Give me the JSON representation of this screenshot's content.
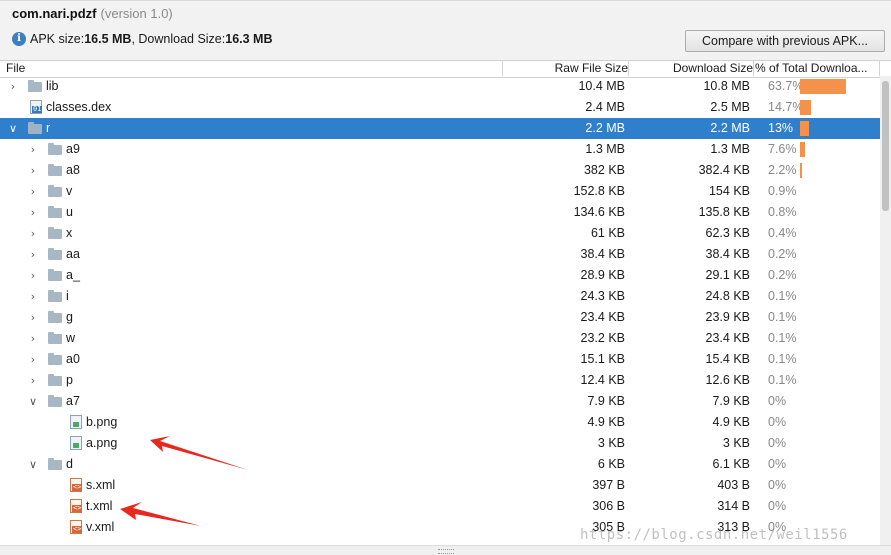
{
  "header": {
    "package": "com.nari.pdzf",
    "version": "(version 1.0)",
    "apk_size_label": "APK size: ",
    "apk_size": "16.5 MB",
    "download_size_label": ", Download Size: ",
    "download_size": "16.3 MB",
    "compare_button": "Compare with previous APK..."
  },
  "columns": {
    "file": "File",
    "raw": "Raw File Size",
    "download": "Download Size",
    "percent": "% of Total Downloa..."
  },
  "rows": [
    {
      "name": "lib",
      "type": "folder",
      "depth": 0,
      "expanded": false,
      "raw": "10.4 MB",
      "dl": "10.8 MB",
      "pct": "63.7%",
      "share": 63.7
    },
    {
      "name": "classes.dex",
      "type": "dex",
      "depth": 0,
      "expanded": null,
      "raw": "2.4 MB",
      "dl": "2.5 MB",
      "pct": "14.7%",
      "share": 14.7
    },
    {
      "name": "r",
      "type": "folder",
      "depth": 0,
      "expanded": true,
      "selected": true,
      "raw": "2.2 MB",
      "dl": "2.2 MB",
      "pct": "13%",
      "share": 13
    },
    {
      "name": "a9",
      "type": "folder",
      "depth": 1,
      "expanded": false,
      "raw": "1.3 MB",
      "dl": "1.3 MB",
      "pct": "7.6%",
      "share": 7.6
    },
    {
      "name": "a8",
      "type": "folder",
      "depth": 1,
      "expanded": false,
      "raw": "382 KB",
      "dl": "382.4 KB",
      "pct": "2.2%",
      "share": 2.2
    },
    {
      "name": "v",
      "type": "folder",
      "depth": 1,
      "expanded": false,
      "raw": "152.8 KB",
      "dl": "154 KB",
      "pct": "0.9%",
      "share": 0
    },
    {
      "name": "u",
      "type": "folder",
      "depth": 1,
      "expanded": false,
      "raw": "134.6 KB",
      "dl": "135.8 KB",
      "pct": "0.8%",
      "share": 0
    },
    {
      "name": "x",
      "type": "folder",
      "depth": 1,
      "expanded": false,
      "raw": "61 KB",
      "dl": "62.3 KB",
      "pct": "0.4%",
      "share": 0
    },
    {
      "name": "aa",
      "type": "folder",
      "depth": 1,
      "expanded": false,
      "raw": "38.4 KB",
      "dl": "38.4 KB",
      "pct": "0.2%",
      "share": 0
    },
    {
      "name": "a_",
      "type": "folder",
      "depth": 1,
      "expanded": false,
      "raw": "28.9 KB",
      "dl": "29.1 KB",
      "pct": "0.2%",
      "share": 0
    },
    {
      "name": "i",
      "type": "folder",
      "depth": 1,
      "expanded": false,
      "raw": "24.3 KB",
      "dl": "24.8 KB",
      "pct": "0.1%",
      "share": 0
    },
    {
      "name": "g",
      "type": "folder",
      "depth": 1,
      "expanded": false,
      "raw": "23.4 KB",
      "dl": "23.9 KB",
      "pct": "0.1%",
      "share": 0
    },
    {
      "name": "w",
      "type": "folder",
      "depth": 1,
      "expanded": false,
      "raw": "23.2 KB",
      "dl": "23.4 KB",
      "pct": "0.1%",
      "share": 0
    },
    {
      "name": "a0",
      "type": "folder",
      "depth": 1,
      "expanded": false,
      "raw": "15.1 KB",
      "dl": "15.4 KB",
      "pct": "0.1%",
      "share": 0
    },
    {
      "name": "p",
      "type": "folder",
      "depth": 1,
      "expanded": false,
      "raw": "12.4 KB",
      "dl": "12.6 KB",
      "pct": "0.1%",
      "share": 0
    },
    {
      "name": "a7",
      "type": "folder",
      "depth": 1,
      "expanded": true,
      "raw": "7.9 KB",
      "dl": "7.9 KB",
      "pct": "0%",
      "share": 0
    },
    {
      "name": "b.png",
      "type": "png",
      "depth": 2,
      "expanded": null,
      "raw": "4.9 KB",
      "dl": "4.9 KB",
      "pct": "0%",
      "share": 0
    },
    {
      "name": "a.png",
      "type": "png",
      "depth": 2,
      "expanded": null,
      "raw": "3 KB",
      "dl": "3 KB",
      "pct": "0%",
      "share": 0
    },
    {
      "name": "d",
      "type": "folder",
      "depth": 1,
      "expanded": true,
      "raw": "6 KB",
      "dl": "6.1 KB",
      "pct": "0%",
      "share": 0
    },
    {
      "name": "s.xml",
      "type": "xml",
      "depth": 2,
      "expanded": null,
      "raw": "397 B",
      "dl": "403 B",
      "pct": "0%",
      "share": 0
    },
    {
      "name": "t.xml",
      "type": "xml",
      "depth": 2,
      "expanded": null,
      "raw": "306 B",
      "dl": "314 B",
      "pct": "0%",
      "share": 0
    },
    {
      "name": "v.xml",
      "type": "xml",
      "depth": 2,
      "expanded": null,
      "raw": "305 B",
      "dl": "313 B",
      "pct": "0%",
      "share": 0
    }
  ],
  "watermark": "https://blog.csdn.net/weil1556",
  "colors": {
    "selection": "#2f7fcc",
    "bar": "#f4914a",
    "arrow": "#e8271f"
  }
}
